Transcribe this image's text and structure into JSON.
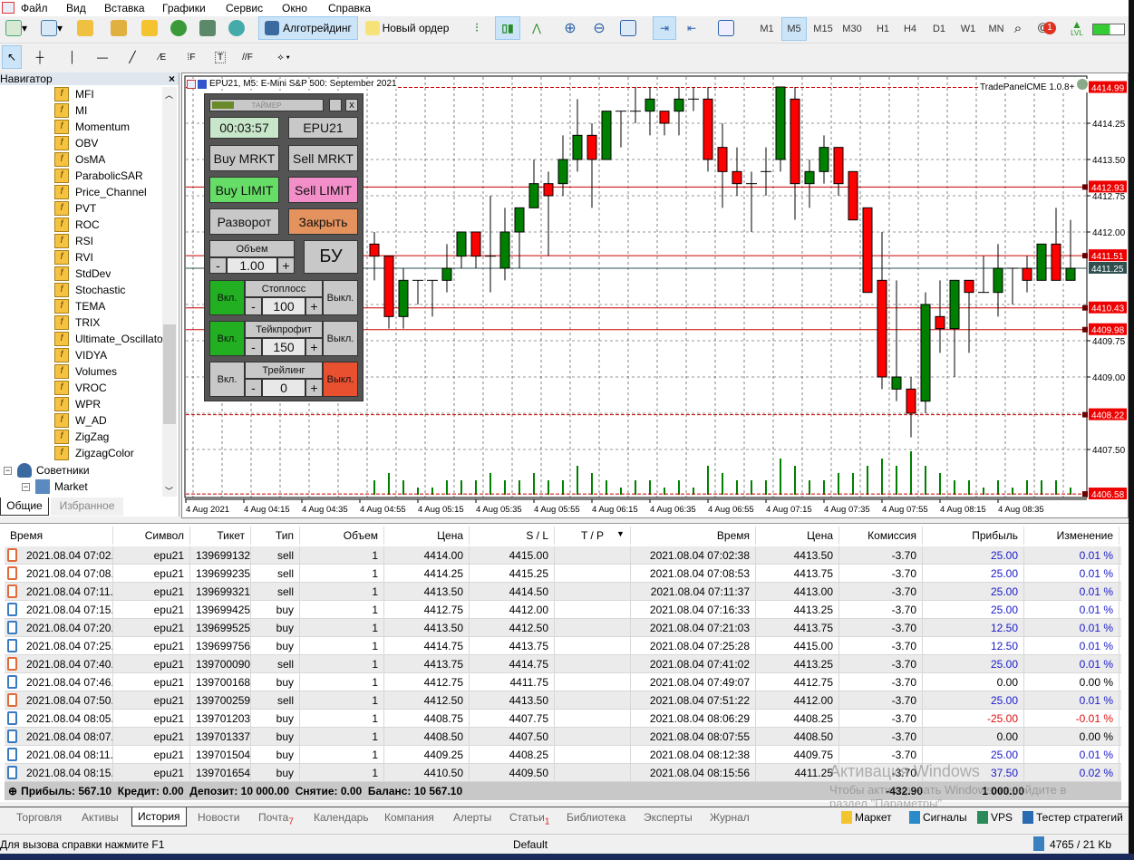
{
  "menu": [
    "Файл",
    "Вид",
    "Вставка",
    "Графики",
    "Сервис",
    "Окно",
    "Справка"
  ],
  "toolbar": {
    "algo": "Алготрейдинг",
    "new_order": "Новый ордер",
    "timeframes": [
      "M1",
      "M5",
      "M15",
      "M30",
      "H1",
      "H4",
      "D1",
      "W1",
      "MN"
    ],
    "active_tf": "M5",
    "notif_count": "1",
    "lvl": "LVL"
  },
  "navigator": {
    "title": "Навигатор",
    "close": "×",
    "items": [
      "MFI",
      "MI",
      "Momentum",
      "OBV",
      "OsMA",
      "ParabolicSAR",
      "Price_Channel",
      "PVT",
      "ROC",
      "RSI",
      "RVI",
      "StdDev",
      "Stochastic",
      "TEMA",
      "TRIX",
      "Ultimate_Oscillator",
      "VIDYA",
      "Volumes",
      "VROC",
      "WPR",
      "W_AD",
      "ZigZag",
      "ZigzagColor"
    ],
    "experts": "Советники",
    "market": "Market",
    "tabs": [
      "Общие",
      "Избранное"
    ]
  },
  "chart": {
    "title": "EPU21, M5: E-Mini S&P 500: September 2021",
    "ea_label": "TradePanelCME 1.0.8+"
  },
  "panel": {
    "title": "ТАЙМЕР",
    "close": "x",
    "timer": "00:03:57",
    "symbol": "EPU21",
    "buy_mrkt": "Buy MRKT",
    "sell_mrkt": "Sell MRKT",
    "buy_limit": "Buy LIMIT",
    "sell_limit": "Sell LIMIT",
    "reverse": "Разворот",
    "close_all": "Закрыть",
    "volume_label": "Объем",
    "volume": "1.00",
    "be": "БУ",
    "minus": "-",
    "plus": "+",
    "on": "Вкл.",
    "off": "Выкл.",
    "sl_label": "Стоплосс",
    "sl": "100",
    "tp_label": "Тейкпрофит",
    "tp": "150",
    "trail_label": "Трейлинг",
    "trail": "0"
  },
  "chart_data": {
    "type": "candlestick",
    "symbol": "EPU21",
    "timeframe": "M5",
    "candles": [
      [
        4411.75,
        4412,
        4411,
        4411.5
      ],
      [
        4411.5,
        4411.5,
        4410,
        4410.25
      ],
      [
        4410.25,
        4411.25,
        4410,
        4411
      ],
      [
        4411,
        4411,
        4410.5,
        4411
      ],
      [
        4411,
        4411,
        4410.25,
        4411
      ],
      [
        4411,
        4411.75,
        4410.75,
        4411.25
      ],
      [
        4411.5,
        4412,
        4411.25,
        4412
      ],
      [
        4412,
        4412,
        4411.25,
        4411.5
      ],
      [
        4411.5,
        4412.75,
        4410.75,
        4411.5
      ],
      [
        4411.25,
        4412.5,
        4411,
        4412
      ],
      [
        4412,
        4412.5,
        4411.25,
        4412.5
      ],
      [
        4412.5,
        4413.5,
        4412.5,
        4413
      ],
      [
        4413,
        4413.25,
        4411.5,
        4412.75
      ],
      [
        4413,
        4414,
        4412.75,
        4413.5
      ],
      [
        4413.5,
        4414.75,
        4413.25,
        4414
      ],
      [
        4414,
        4414.25,
        4412.5,
        4413.5
      ],
      [
        4413.5,
        4414.5,
        4413.5,
        4414.5
      ],
      [
        4414.5,
        4414.5,
        4413.75,
        4414.5
      ],
      [
        4414.5,
        4415,
        4414.25,
        4414.5
      ],
      [
        4414.5,
        4415,
        4414,
        4414.75
      ],
      [
        4414.5,
        4414.5,
        4414,
        4414.25
      ],
      [
        4414.5,
        4415,
        4414,
        4414.75
      ],
      [
        4414.75,
        4415,
        4414.5,
        4414.75
      ],
      [
        4414.75,
        4415,
        4413.25,
        4413.5
      ],
      [
        4413.75,
        4414.25,
        4412.5,
        4413.25
      ],
      [
        4413.25,
        4413.75,
        4412.75,
        4413
      ],
      [
        4413,
        4413.25,
        4412,
        4413
      ],
      [
        4413.25,
        4413.75,
        4412.75,
        4413.25
      ],
      [
        4413.5,
        4415,
        4413.25,
        4415
      ],
      [
        4414.75,
        4415,
        4412.25,
        4413
      ],
      [
        4413,
        4413.5,
        4412.5,
        4413.25
      ],
      [
        4413.25,
        4414,
        4413,
        4413.75
      ],
      [
        4413.75,
        4413.75,
        4412.75,
        4413
      ],
      [
        4413.25,
        4413.25,
        4412.25,
        4412.25
      ],
      [
        4412.5,
        4412.5,
        4410.75,
        4410.75
      ],
      [
        4411,
        4412,
        4408.75,
        4409
      ],
      [
        4408.75,
        4411,
        4408.5,
        4409
      ],
      [
        4408.75,
        4409,
        4407.75,
        4408.25
      ],
      [
        4408.5,
        4410.75,
        4408.25,
        4410.5
      ],
      [
        4410.25,
        4411,
        4409.5,
        4410
      ],
      [
        4410,
        4411,
        4409,
        4411
      ],
      [
        4411,
        4411,
        4409.5,
        4410.75
      ],
      [
        4410.75,
        4411.5,
        4410.75,
        4410.75
      ],
      [
        4410.75,
        4411.75,
        4410.25,
        4411.25
      ],
      [
        4411.25,
        4411.25,
        4410.5,
        4411.25
      ],
      [
        4411.25,
        4411.5,
        4410.75,
        4411
      ],
      [
        4411,
        4411.75,
        4411,
        4411.75
      ],
      [
        4411.75,
        4412.5,
        4411,
        4411
      ],
      [
        4411,
        4412.25,
        4411,
        4411.25
      ]
    ],
    "volumes": [
      2,
      3,
      2,
      1,
      1,
      2,
      2,
      2,
      3,
      2,
      2,
      3,
      2,
      2,
      4,
      3,
      2,
      1,
      2,
      2,
      1,
      2,
      1,
      4,
      3,
      2,
      2,
      2,
      5,
      4,
      2,
      2,
      3,
      3,
      4,
      5,
      4,
      6,
      4,
      3,
      2,
      2,
      1,
      2,
      1,
      2,
      2,
      2,
      1
    ],
    "y_ticks": [
      "4414.25",
      "4413.50",
      "4412.75",
      "4412.00",
      "4409.75",
      "4409.00",
      "4407.50"
    ],
    "x_ticks": [
      "4 Aug 2021",
      "4 Aug 04:15",
      "4 Aug 04:35",
      "4 Aug 04:55",
      "4 Aug 05:15",
      "4 Aug 05:35",
      "4 Aug 05:55",
      "4 Aug 06:15",
      "4 Aug 06:35",
      "4 Aug 06:55",
      "4 Aug 07:15",
      "4 Aug 07:35",
      "4 Aug 07:55",
      "4 Aug 08:15",
      "4 Aug 08:35"
    ],
    "levels": [
      {
        "price": "4414.99",
        "dashed": true
      },
      {
        "price": "4412.93",
        "dashed": false
      },
      {
        "price": "4411.51",
        "dashed": false
      },
      {
        "price": "4410.43",
        "dashed": false
      },
      {
        "price": "4409.98",
        "dashed": false
      },
      {
        "price": "4408.22",
        "dashed": true
      },
      {
        "price": "4406.58",
        "dashed": true
      }
    ],
    "bid": "4411.25",
    "colors": {
      "up": "#008000",
      "down": "#ff0000",
      "level": "#cc0000",
      "bid": "#2f4f4f"
    }
  },
  "table": {
    "headers": [
      "Время",
      "Символ",
      "Тикет",
      "Тип",
      "Объем",
      "Цена",
      "S / L",
      "T / P",
      "Время",
      "Цена",
      "Комиссия",
      "Прибыль",
      "Изменение"
    ],
    "rows": [
      [
        "2021.08.04 07:02...",
        "epu21",
        "139699132",
        "sell",
        "1",
        "4414.00",
        "4415.00",
        "",
        "2021.08.04 07:02:38",
        "4413.50",
        "-3.70",
        "25.00",
        "0.01 %"
      ],
      [
        "2021.08.04 07:08...",
        "epu21",
        "139699235",
        "sell",
        "1",
        "4414.25",
        "4415.25",
        "",
        "2021.08.04 07:08:53",
        "4413.75",
        "-3.70",
        "25.00",
        "0.01 %"
      ],
      [
        "2021.08.04 07:11...",
        "epu21",
        "139699321",
        "sell",
        "1",
        "4413.50",
        "4414.50",
        "",
        "2021.08.04 07:11:37",
        "4413.00",
        "-3.70",
        "25.00",
        "0.01 %"
      ],
      [
        "2021.08.04 07:15...",
        "epu21",
        "139699425",
        "buy",
        "1",
        "4412.75",
        "4412.00",
        "",
        "2021.08.04 07:16:33",
        "4413.25",
        "-3.70",
        "25.00",
        "0.01 %"
      ],
      [
        "2021.08.04 07:20...",
        "epu21",
        "139699525",
        "buy",
        "1",
        "4413.50",
        "4412.50",
        "",
        "2021.08.04 07:21:03",
        "4413.75",
        "-3.70",
        "12.50",
        "0.01 %"
      ],
      [
        "2021.08.04 07:25...",
        "epu21",
        "139699756",
        "buy",
        "1",
        "4414.75",
        "4413.75",
        "",
        "2021.08.04 07:25:28",
        "4415.00",
        "-3.70",
        "12.50",
        "0.01 %"
      ],
      [
        "2021.08.04 07:40...",
        "epu21",
        "139700090",
        "sell",
        "1",
        "4413.75",
        "4414.75",
        "",
        "2021.08.04 07:41:02",
        "4413.25",
        "-3.70",
        "25.00",
        "0.01 %"
      ],
      [
        "2021.08.04 07:46...",
        "epu21",
        "139700168",
        "buy",
        "1",
        "4412.75",
        "4411.75",
        "",
        "2021.08.04 07:49:07",
        "4412.75",
        "-3.70",
        "0.00",
        "0.00 %"
      ],
      [
        "2021.08.04 07:50...",
        "epu21",
        "139700259",
        "sell",
        "1",
        "4412.50",
        "4413.50",
        "",
        "2021.08.04 07:51:22",
        "4412.00",
        "-3.70",
        "25.00",
        "0.01 %"
      ],
      [
        "2021.08.04 08:05...",
        "epu21",
        "139701203",
        "buy",
        "1",
        "4408.75",
        "4407.75",
        "",
        "2021.08.04 08:06:29",
        "4408.25",
        "-3.70",
        "-25.00",
        "-0.01 %"
      ],
      [
        "2021.08.04 08:07...",
        "epu21",
        "139701337",
        "buy",
        "1",
        "4408.50",
        "4407.50",
        "",
        "2021.08.04 08:07:55",
        "4408.50",
        "-3.70",
        "0.00",
        "0.00 %"
      ],
      [
        "2021.08.04 08:11...",
        "epu21",
        "139701504",
        "buy",
        "1",
        "4409.25",
        "4408.25",
        "",
        "2021.08.04 08:12:38",
        "4409.75",
        "-3.70",
        "25.00",
        "0.01 %"
      ],
      [
        "2021.08.04 08:15...",
        "epu21",
        "139701654",
        "buy",
        "1",
        "4410.50",
        "4409.50",
        "",
        "2021.08.04 08:15:56",
        "4411.25",
        "-3.70",
        "37.50",
        "0.02 %"
      ]
    ],
    "summary": "Прибыль: 567.10  Кредит: 0.00  Депозит: 10 000.00  Снятие: 0.00  Баланс: 10 567.10",
    "sum_commission": "-432.90",
    "sum_profit": "1 000.00"
  },
  "watermark": {
    "line1": "Активация Windows",
    "line2": "Чтобы активировать Windows, перейдите в",
    "line3": "раздел \"Параметры\"."
  },
  "tabs": [
    "Торговля",
    "Активы",
    "История",
    "Новости",
    "Почта",
    "Календарь",
    "Компания",
    "Алерты",
    "Статьи",
    "Библиотека",
    "Эксперты",
    "Журнал"
  ],
  "tab_badges": {
    "mail": "7",
    "articles": "1"
  },
  "right_tabs": [
    "Маркет",
    "Сигналы",
    "VPS",
    "Тестер стратегий"
  ],
  "status": {
    "help": "Для вызова справки нажмите F1",
    "profile": "Default",
    "traffic": "4765 / 21 Kb"
  }
}
